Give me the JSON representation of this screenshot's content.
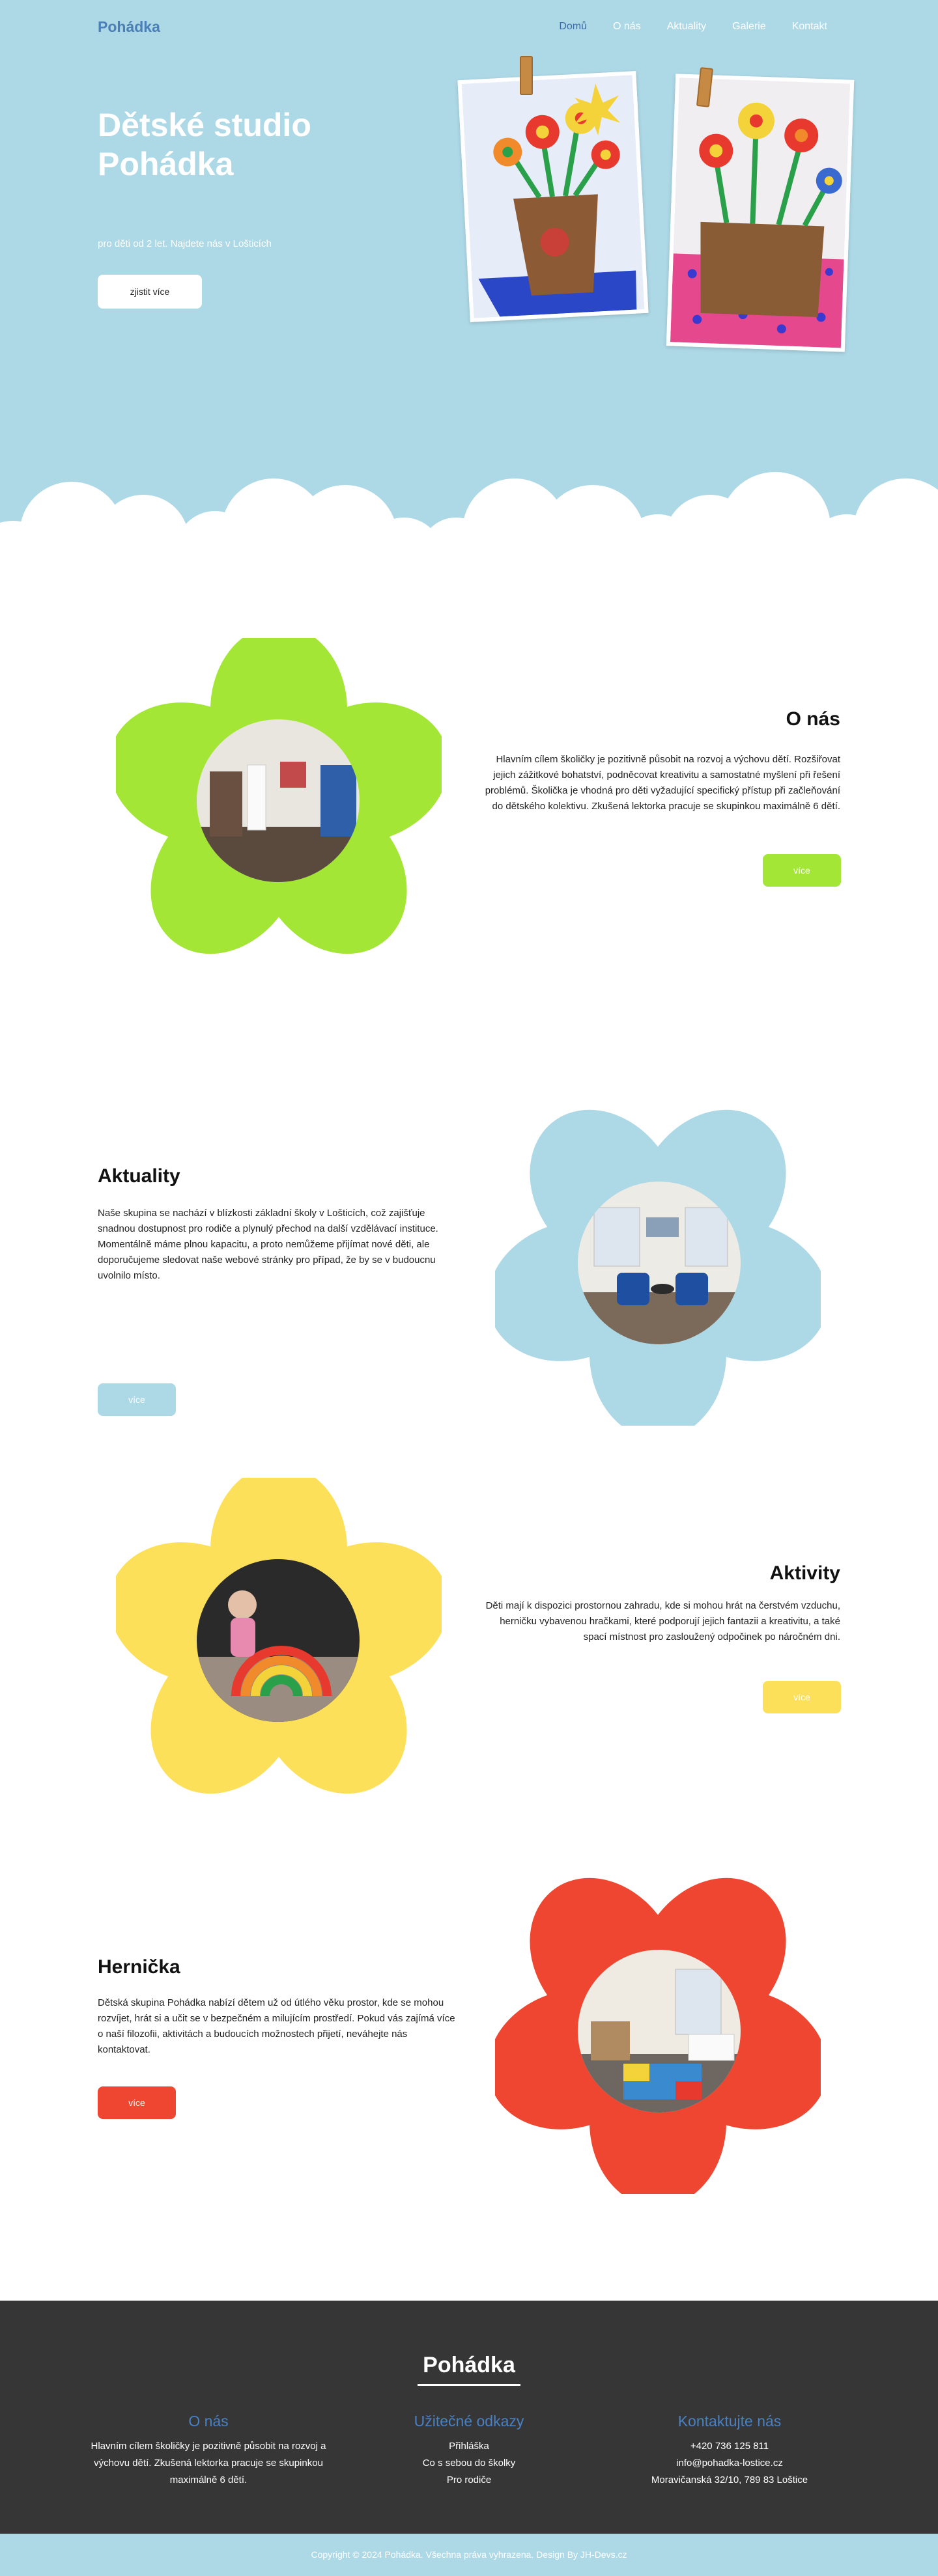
{
  "nav": {
    "logo": "Pohádka",
    "items": [
      "Domů",
      "O nás",
      "Aktuality",
      "Galerie",
      "Kontakt"
    ]
  },
  "hero": {
    "title": "Dětské studio Pohádka",
    "subtitle": "pro děti od 2 let. Najdete nás v Lošticích",
    "button": "zjistit více"
  },
  "sections": [
    {
      "title": "O nás",
      "text": "Hlavním cílem školičky je pozitivně působit na rozvoj a výchovu dětí. Rozšiřovat jejich zážitkové bohatství, podněcovat kreativitu a samostatné myšlení při řešení problémů. Školička je vhodná pro děti vyžadující specifický přístup při začleňování do dětského kolektivu. Zkušená lektorka pracuje se skupinkou maximálně 6 dětí.",
      "button": "více",
      "color": "#a3e635"
    },
    {
      "title": "Aktuality",
      "text": "Naše skupina se nachází v blízkosti základní školy v Lošticích, což zajišťuje snadnou dostupnost pro rodiče a plynulý přechod na další vzdělávací instituce. Momentálně máme plnou kapacitu, a proto nemůžeme přijímat nové děti, ale doporučujeme sledovat naše webové stránky pro případ, že by se v budoucnu uvolnilo místo.",
      "button": "více",
      "color": "#add8e6"
    },
    {
      "title": "Aktivity",
      "text": "Děti mají k dispozici prostornou zahradu, kde si mohou hrát na čerstvém vzduchu, herničku vybavenou hračkami, které podporují jejich fantazii a kreativitu, a také spací místnost pro zasloužený odpočinek po náročném dni.",
      "button": "více",
      "color": "#fde05a"
    },
    {
      "title": "Hernička",
      "text": "Dětská skupina Pohádka nabízí dětem už od útlého věku prostor, kde se mohou rozvíjet, hrát si a učit se v bezpečném a milujícím prostředí. Pokud vás zajímá více o naší filozofii, aktivitách a budoucích možnostech přijetí, neváhejte nás kontaktovat.",
      "button": "více",
      "color": "#ee4630"
    }
  ],
  "footer": {
    "logo": "Pohádka",
    "about_title": "O nás",
    "about_text": "Hlavním cílem školičky je pozitivně působit na rozvoj a výchovu dětí. Zkušená lektorka pracuje se skupinkou maximálně 6 dětí.",
    "links_title": "Užitečné odkazy",
    "links": [
      "Přihláška",
      "Co s sebou do školky",
      "Pro rodiče"
    ],
    "contact_title": "Kontaktujte nás",
    "phone": "+420 736 125 811",
    "email": "info@pohadka-lostice.cz",
    "address": "Moravičanská 32/10, 789 83 Loštice"
  },
  "copyright": "Copyright © 2024 Pohádka. Všechna práva vyhrazena. Design By JH-Devs.cz"
}
